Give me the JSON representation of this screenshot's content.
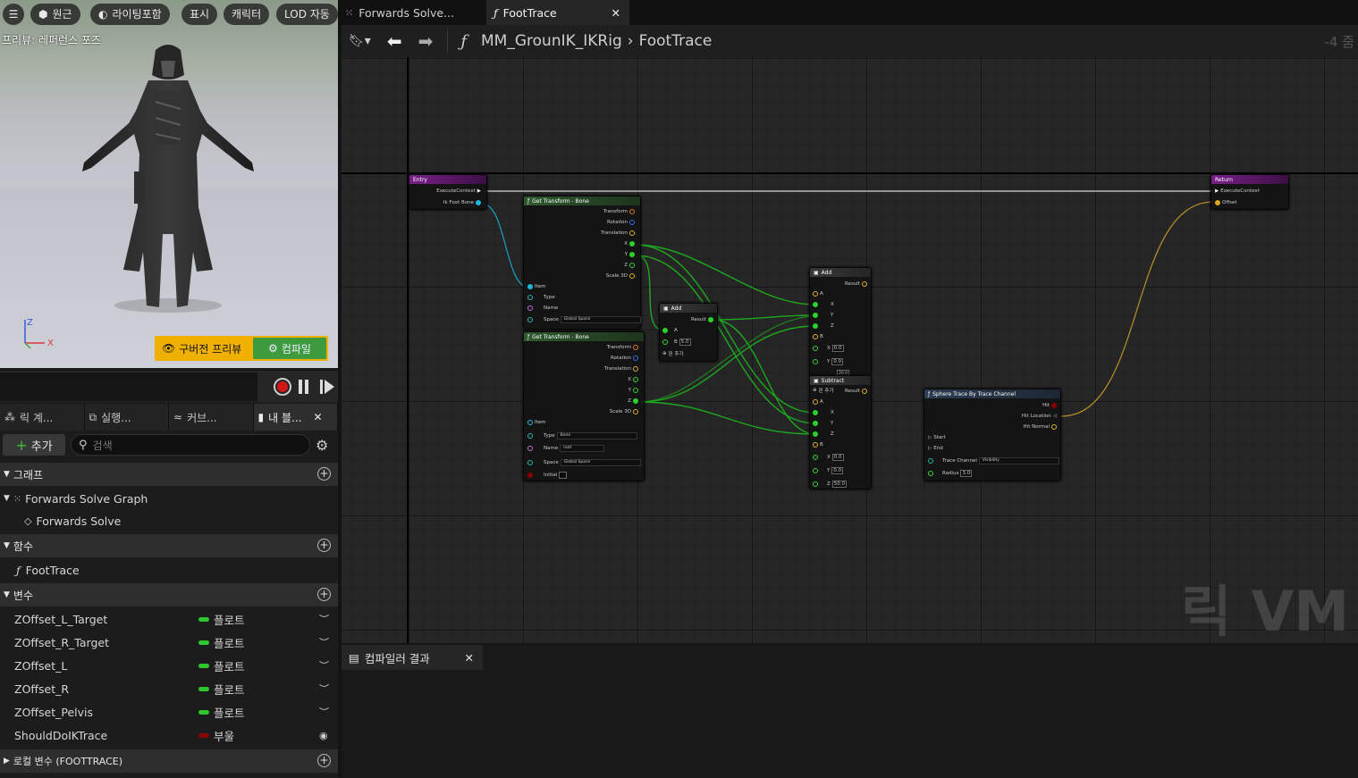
{
  "viewport": {
    "btn_menu": "☰",
    "btn_perspective": "원근",
    "btn_lighting": "라이팅포함",
    "btn_show": "표시",
    "btn_character": "캐릭터",
    "btn_lod": "LOD 자동",
    "preview_label": "프리뷰: 레퍼런스 포즈",
    "axis_z": "Z",
    "axis_x": "X",
    "old_preview_label": "구버전 프리뷰",
    "compile_label": "컴파일"
  },
  "panel_tabs": [
    "릭 계...",
    "실행...",
    "커브...",
    "내 블..."
  ],
  "toolbar": {
    "add_label": "추가",
    "search_placeholder": "검색"
  },
  "sections": {
    "graph": "그래프",
    "functions": "함수",
    "variables": "변수",
    "local_vars": "로컬 변수 (FOOTTRACE)"
  },
  "graph_items": {
    "forwards_solve_graph": "Forwards Solve Graph",
    "forwards_solve": "Forwards Solve"
  },
  "function_items": {
    "foot_trace": "FootTrace"
  },
  "variables": [
    {
      "name": "ZOffset_L_Target",
      "type": "플로트",
      "color": "#2ec82e"
    },
    {
      "name": "ZOffset_R_Target",
      "type": "플로트",
      "color": "#2ec82e"
    },
    {
      "name": "ZOffset_L",
      "type": "플로트",
      "color": "#2ec82e"
    },
    {
      "name": "ZOffset_R",
      "type": "플로트",
      "color": "#2ec82e"
    },
    {
      "name": "ZOffset_Pelvis",
      "type": "플로트",
      "color": "#2ec82e"
    },
    {
      "name": "ShouldDoIKTrace",
      "type": "부울",
      "color": "#8a0000"
    }
  ],
  "tabs": {
    "tab1": "Forwards Solve...",
    "tab2": "FootTrace"
  },
  "breadcrumb": {
    "asset": "MM_GrounIK_IKRig",
    "func": "FootTrace",
    "zoom": "-4 줌"
  },
  "watermark": "릭 VM",
  "compiler": {
    "tab": "컴파일러 결과"
  },
  "nodes": {
    "entry": {
      "title": "Entry",
      "exec": "ExecuteContext",
      "bone": "Ik Foot Bone"
    },
    "return": {
      "title": "Return",
      "exec": "ExecuteContext",
      "offset": "Offset"
    },
    "gtb1": {
      "title": "Get Transform - Bone",
      "transform": "Transform",
      "rotation": "Rotation",
      "translation": "Translation",
      "x": "X",
      "y": "Y",
      "z": "Z",
      "scale": "Scale 3D",
      "item": "Item",
      "type": "Type",
      "name": "Name",
      "space": "Space",
      "space_val": "Global Space"
    },
    "gtb2": {
      "title": "Get Transform - Bone",
      "transform": "Transform",
      "rotation": "Rotation",
      "translation": "Translation",
      "x": "X",
      "y": "Y",
      "z": "Z",
      "scale": "Scale 3D",
      "item": "Item",
      "type": "Type",
      "type_val": "Bone",
      "name": "Name",
      "name_val": "root",
      "space": "Space",
      "space_val": "Global Space",
      "initial": "Initial"
    },
    "add1": {
      "title": "Add",
      "result": "Result",
      "a": "A",
      "b": "B",
      "b_val": "5.0",
      "add_pin": "핀 추가"
    },
    "add2": {
      "title": "Add",
      "result": "Result",
      "a": "A",
      "x": "X",
      "y": "Y",
      "z": "Z",
      "b": "B",
      "bx": "0.0",
      "by": "0.0",
      "bz": "20.0",
      "add_pin": "핀 추가"
    },
    "sub": {
      "title": "Subtract",
      "result": "Result",
      "a": "A",
      "x": "X",
      "y": "Y",
      "z": "Z",
      "b": "B",
      "bx": "0.0",
      "by": "0.0",
      "bz": "50.0"
    },
    "sphere": {
      "title": "Sphere Trace By Trace Channel",
      "hit": "Hit",
      "hit_location": "Hit Location",
      "hit_normal": "Hit Normal",
      "start": "Start",
      "end": "End",
      "trace_channel": "Trace Channel",
      "trace_val": "Visibility",
      "radius": "Radius",
      "radius_val": "3.0"
    }
  }
}
